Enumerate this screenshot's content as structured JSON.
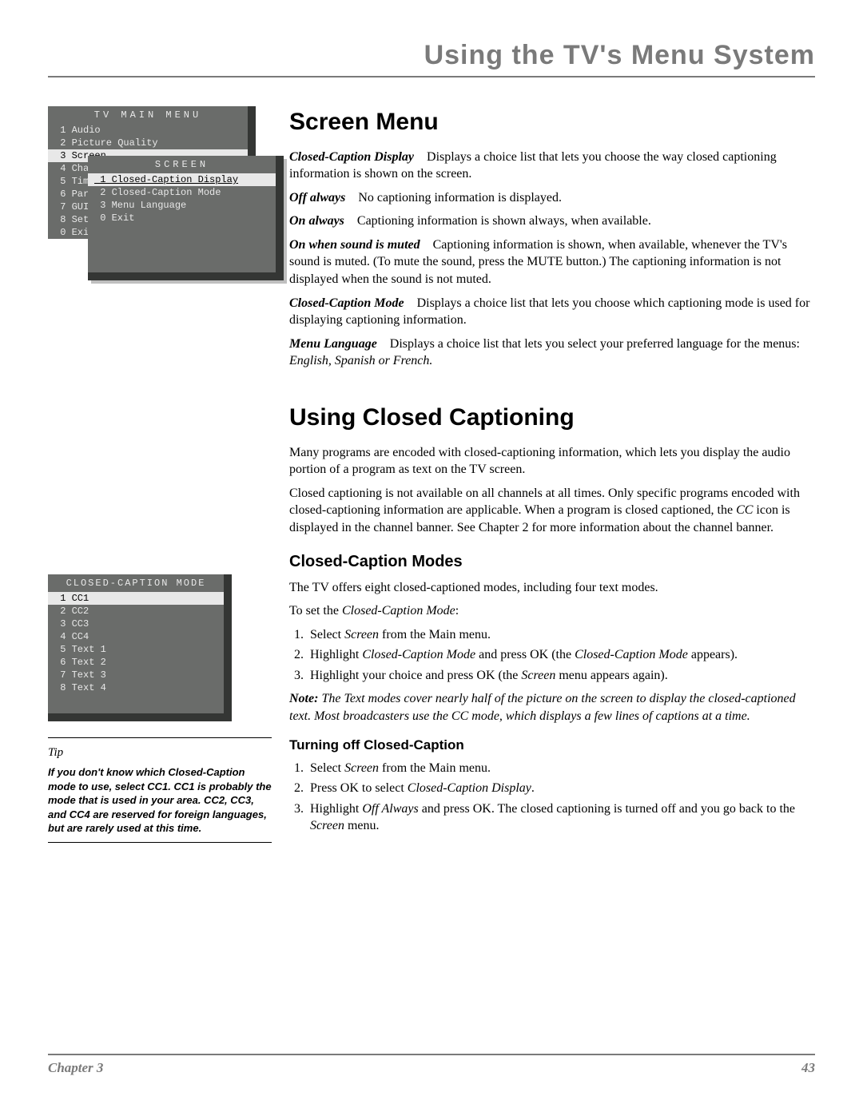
{
  "page_title": "Using the TV's Menu System",
  "footer": {
    "left": "Chapter 3",
    "right": "43"
  },
  "shot1": {
    "title": "TV MAIN MENU",
    "main_items": [
      {
        "n": "1",
        "label": "Audio"
      },
      {
        "n": "2",
        "label": "Picture Quality"
      },
      {
        "n": "3",
        "label": "Screen",
        "selected": true
      },
      {
        "n": "4",
        "label": "Channel"
      },
      {
        "n": "5",
        "label": "Time"
      },
      {
        "n": "6",
        "label": "Parental"
      },
      {
        "n": "7",
        "label": "GUIDE"
      },
      {
        "n": "8",
        "label": "Setup"
      },
      {
        "n": "0",
        "label": "Exit"
      }
    ],
    "sub_title": "SCREEN",
    "sub_items": [
      {
        "n": "1",
        "label": "Closed-Caption Display",
        "selected": true
      },
      {
        "n": "2",
        "label": "Closed-Caption Mode"
      },
      {
        "n": "3",
        "label": "Menu Language"
      },
      {
        "n": "0",
        "label": "Exit"
      }
    ]
  },
  "shot2": {
    "title": "CLOSED-CAPTION MODE",
    "items": [
      {
        "n": "1",
        "label": "CC1",
        "selected": true
      },
      {
        "n": "2",
        "label": "CC2"
      },
      {
        "n": "3",
        "label": "CC3"
      },
      {
        "n": "4",
        "label": "CC4"
      },
      {
        "n": "5",
        "label": "Text 1"
      },
      {
        "n": "6",
        "label": "Text 2"
      },
      {
        "n": "7",
        "label": "Text 3"
      },
      {
        "n": "8",
        "label": "Text 4"
      }
    ]
  },
  "tip": {
    "title": "Tip",
    "body": "If you don't know which Closed-Caption mode to use, select CC1. CC1 is probably the mode that is used in your area. CC2, CC3, and CC4 are reserved for foreign languages, but are rarely used at this time."
  },
  "s1_h": "Screen Menu",
  "ccd_term": "Closed-Caption Display",
  "ccd_text": "Displays a choice list that lets you choose the way closed captioning information is shown on the screen.",
  "opt1_t": "Off always",
  "opt1_d": "No captioning information is displayed.",
  "opt2_t": "On always",
  "opt2_d": "Captioning information is shown always, when available.",
  "opt3_t": "On when sound is muted",
  "opt3_d": "Captioning information is shown, when available, whenever the TV's sound is muted. (To mute the sound, press the MUTE button.) The captioning information is not displayed when the sound is not muted.",
  "ccm_term": "Closed-Caption Mode",
  "ccm_text": "Displays a choice list that lets you choose which captioning mode is used for displaying captioning information.",
  "ml_term": "Menu Language",
  "ml_text_a": "Displays a choice list that lets you select your preferred language for the menus: ",
  "ml_langs": "English, Spanish or French.",
  "s2_h": "Using Closed Captioning",
  "s2_p1": "Many programs are encoded with closed-captioning information, which lets you display the audio portion of a program as text on the TV screen.",
  "s2_p2a": "Closed captioning is not available on all channels at all times. Only specific programs encoded with closed-captioning information are applicable. When a program is closed captioned, the ",
  "s2_p2b": "CC",
  "s2_p2c": " icon is displayed in the channel banner. See Chapter 2 for more information about the channel banner.",
  "s3_h": "Closed-Caption Modes",
  "s3_p1": "The TV offers eight closed-captioned modes, including four text modes.",
  "s3_p2a": "To set the ",
  "s3_p2b": "Closed-Caption Mode",
  "s3_p2c": ":",
  "s3_li1a": "Select ",
  "s3_li1b": "Screen",
  "s3_li1c": " from the Main menu.",
  "s3_li2a": "Highlight ",
  "s3_li2b": "Closed-Caption Mode",
  "s3_li2c": " and press OK  (the ",
  "s3_li2d": "Closed-Caption Mode",
  "s3_li2e": " appears).",
  "s3_li3a": "Highlight your choice and press OK (the ",
  "s3_li3b": "Screen",
  "s3_li3c": " menu appears again).",
  "note_t": "Note:",
  "note_b": " The Text modes cover nearly half of the picture on the screen to display the closed-captioned text. Most broadcasters use the CC mode, which displays a few lines of captions at a time.",
  "s4_h": "Turning off Closed-Caption",
  "s4_li1a": "Select ",
  "s4_li1b": "Screen",
  "s4_li1c": " from the Main menu.",
  "s4_li2a": "Press OK to select ",
  "s4_li2b": "Closed-Caption Display",
  "s4_li2c": ".",
  "s4_li3a": "Highlight ",
  "s4_li3b": "Off Always",
  "s4_li3c": " and press OK. The closed captioning is turned off and you go back to the ",
  "s4_li3d": "Screen",
  "s4_li3e": " menu."
}
